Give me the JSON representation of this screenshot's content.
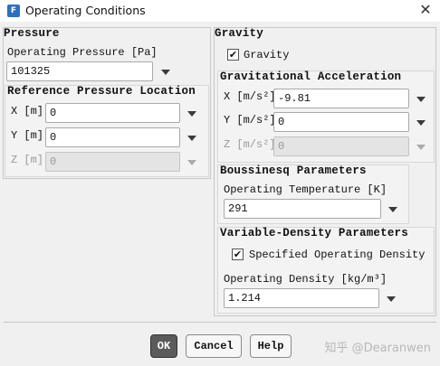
{
  "window": {
    "title": "Operating Conditions",
    "icon_letter": "F"
  },
  "pressure": {
    "section_title": "Pressure",
    "operating_pressure_label": "Operating Pressure [Pa]",
    "operating_pressure_value": "101325",
    "ref_location_title": "Reference Pressure Location",
    "x_label": "X [m]",
    "x_value": "0",
    "y_label": "Y [m]",
    "y_value": "0",
    "z_label": "Z [m]",
    "z_value": "0"
  },
  "gravity": {
    "section_title": "Gravity",
    "checkbox_label": "Gravity",
    "checked": true,
    "accel_title": "Gravitational Acceleration",
    "x_label": "X [m/s²]",
    "x_value": "-9.81",
    "y_label": "Y [m/s²]",
    "y_value": "0",
    "z_label": "Z [m/s²]",
    "z_value": "0"
  },
  "boussinesq": {
    "section_title": "Boussinesq Parameters",
    "temp_label": "Operating Temperature [K]",
    "temp_value": "291"
  },
  "variable_density": {
    "section_title": "Variable-Density Parameters",
    "checkbox_label": "Specified Operating Density",
    "checked": true,
    "density_label": "Operating Density [kg/m³]",
    "density_value": "1.214"
  },
  "buttons": {
    "ok": "OK",
    "cancel": "Cancel",
    "help": "Help"
  },
  "watermark": "知乎 @Dearanwen",
  "check_glyph": "✔",
  "close_glyph": "✕"
}
